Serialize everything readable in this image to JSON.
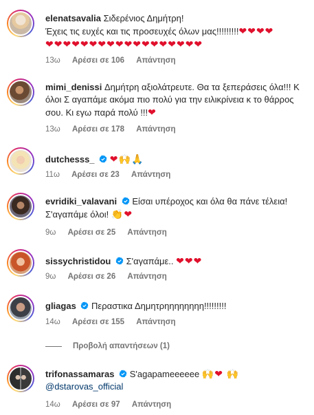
{
  "comments": [
    {
      "username": "elenatsavalia",
      "verified": false,
      "text": "Σιδερένιος Δημήτρη!\nΈχεις τις ευχές και τις προσευχές όλων μας!!!!!!!!!",
      "emoji": "❤❤❤❤\n❤❤❤❤❤❤❤❤❤❤❤❤❤❤❤❤❤❤",
      "time": "13ω",
      "likes": "Αρέσει σε 106",
      "reply": "Απάντηση"
    },
    {
      "username": "mimi_denissi",
      "verified": false,
      "text": "Δημήτρη αξιολάτρευτε. Θα τα ξεπεράσεις όλα!!! Κ όλοι Σ αγαπάμε ακόμα πιο πολύ για την ειλικρίνεια κ το θάρρος σου. Κι εγω παρά πολύ !!!",
      "emoji": "❤",
      "time": "13ω",
      "likes": "Αρέσει σε 178",
      "reply": "Απάντηση"
    },
    {
      "username": "dutchesss_",
      "verified": true,
      "text": "",
      "emoji": "❤🙌🙏",
      "time": "11ω",
      "likes": "Αρέσει σε 23",
      "reply": "Απάντηση"
    },
    {
      "username": "evridiki_valavani",
      "verified": true,
      "text": "Είσαι υπέροχος και όλα θα πάνε τέλεια!\nΣ'αγαπάμε όλοι!",
      "emoji": "👏❤",
      "time": "9ω",
      "likes": "Αρέσει σε 25",
      "reply": "Απάντηση"
    },
    {
      "username": "sissychristidou",
      "verified": true,
      "text": "Σ'αγαπάμε..",
      "emoji": "❤❤❤",
      "time": "9ω",
      "likes": "Αρέσει σε 26",
      "reply": "Απάντηση"
    },
    {
      "username": "gliagas",
      "verified": true,
      "text": "Περαστικα Δημητρηηηηηηηη!!!!!!!!!",
      "emoji": "",
      "time": "14ω",
      "likes": "Αρέσει σε 155",
      "reply": "Απάντηση"
    },
    {
      "username": "trifonassamaras",
      "verified": true,
      "text": "S'agapameeeeee",
      "emoji": "🙌❤ 🙌",
      "mention": "@dstarovas_official",
      "time": "14ω",
      "likes": "Αρέσει σε 97",
      "reply": "Απάντηση"
    }
  ],
  "view_replies": "Προβολή απαντήσεων (1)",
  "colors": {
    "text": "#262626",
    "meta": "#737373",
    "verified": "#0095f6",
    "heart": "#e0102c",
    "mention": "#00376b"
  }
}
